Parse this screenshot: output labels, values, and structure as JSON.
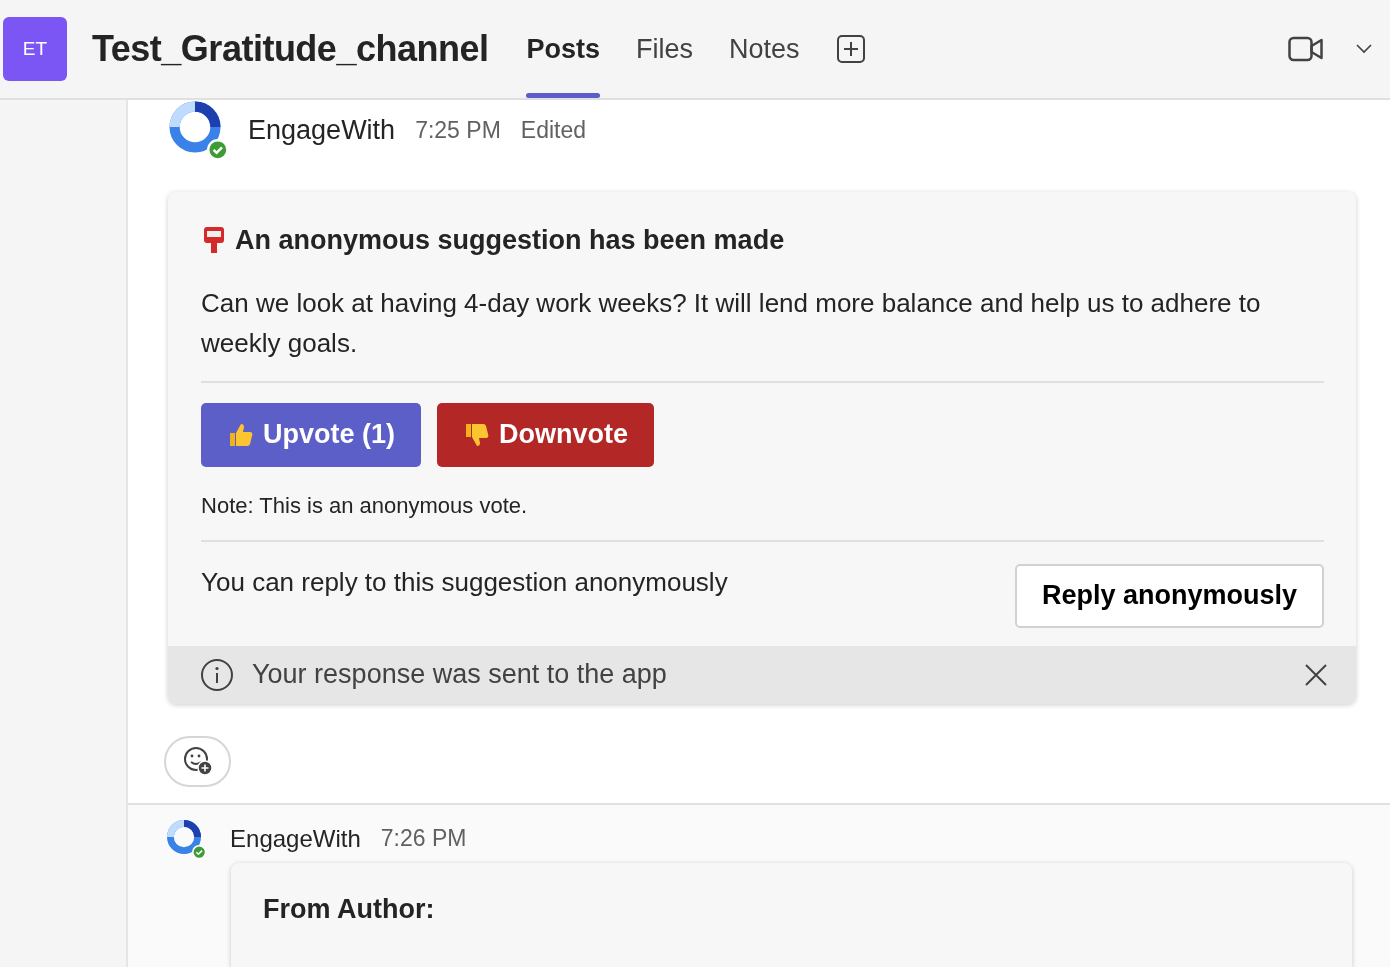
{
  "channel": {
    "initials": "ET",
    "name": "Test_Gratitude_channel"
  },
  "tabs": [
    {
      "label": "Posts",
      "selected": true
    },
    {
      "label": "Files",
      "selected": false
    },
    {
      "label": "Notes",
      "selected": false
    }
  ],
  "messages": [
    {
      "sender": "EngageWith",
      "time": "7:25 PM",
      "status": "Edited",
      "card": {
        "title": "An anonymous suggestion has been made",
        "body": "Can we look at having 4-day work weeks? It will lend more balance and help us to adhere to weekly goals.",
        "votes": [
          {
            "kind": "upvote",
            "label": "Upvote (1)"
          },
          {
            "kind": "downvote",
            "label": "Downvote"
          }
        ],
        "note": "Note: This is an anonymous vote.",
        "reply_prompt": "You can reply to this suggestion anonymously",
        "reply_button": "Reply anonymously",
        "notice": "Your response was sent to the app"
      }
    },
    {
      "sender": "EngageWith",
      "time": "7:26 PM",
      "card": {
        "title": "From Author:"
      }
    }
  ]
}
